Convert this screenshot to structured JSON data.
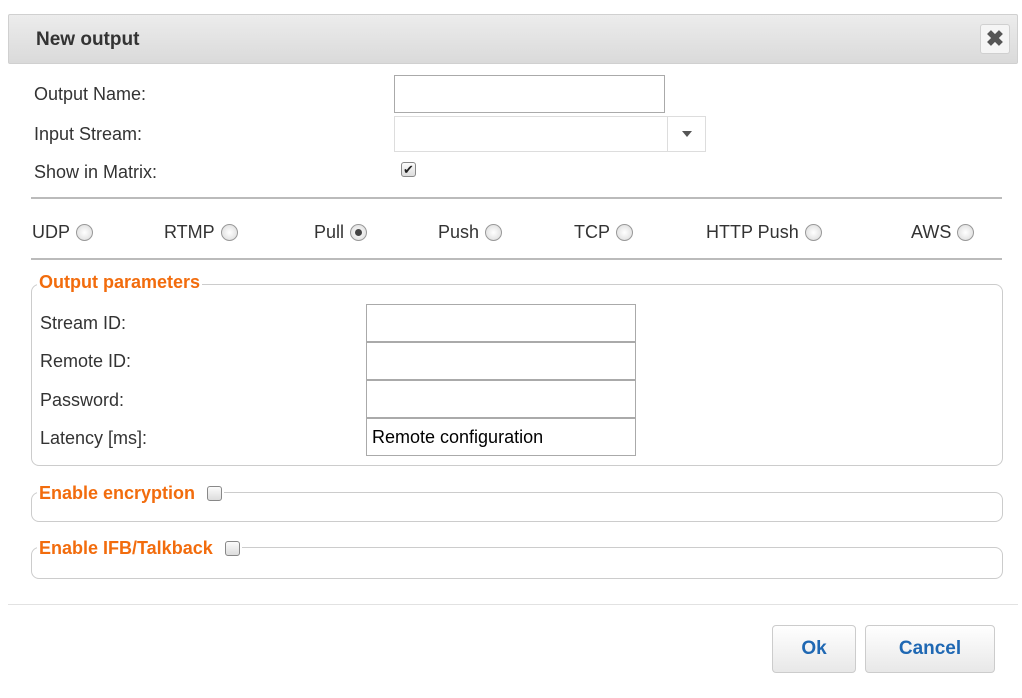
{
  "dialog": {
    "title": "New output",
    "close_glyph": "✖"
  },
  "form": {
    "output_name": {
      "label": "Output Name:",
      "value": ""
    },
    "input_stream": {
      "label": "Input Stream:",
      "value": ""
    },
    "show_in_matrix": {
      "label": "Show in Matrix:",
      "checked": true,
      "check_glyph": "✔"
    }
  },
  "protocols": [
    {
      "label": "UDP",
      "selected": false
    },
    {
      "label": "RTMP",
      "selected": false
    },
    {
      "label": "Pull",
      "selected": true
    },
    {
      "label": "Push",
      "selected": false
    },
    {
      "label": "TCP",
      "selected": false
    },
    {
      "label": "HTTP Push",
      "selected": false
    },
    {
      "label": "AWS",
      "selected": false
    }
  ],
  "output_parameters": {
    "legend": "Output parameters",
    "stream_id": {
      "label": "Stream ID:",
      "value": ""
    },
    "remote_id": {
      "label": "Remote ID:",
      "value": ""
    },
    "password": {
      "label": "Password:",
      "value": ""
    },
    "latency": {
      "label": "Latency [ms]:",
      "value": "Remote configuration"
    }
  },
  "encryption": {
    "legend": "Enable encryption",
    "checked": false
  },
  "ifb": {
    "legend": "Enable IFB/Talkback",
    "checked": false
  },
  "buttons": {
    "ok": "Ok",
    "cancel": "Cancel"
  },
  "colors": {
    "accent_orange": "#f26c0d",
    "button_text_blue": "#1f68b3"
  }
}
